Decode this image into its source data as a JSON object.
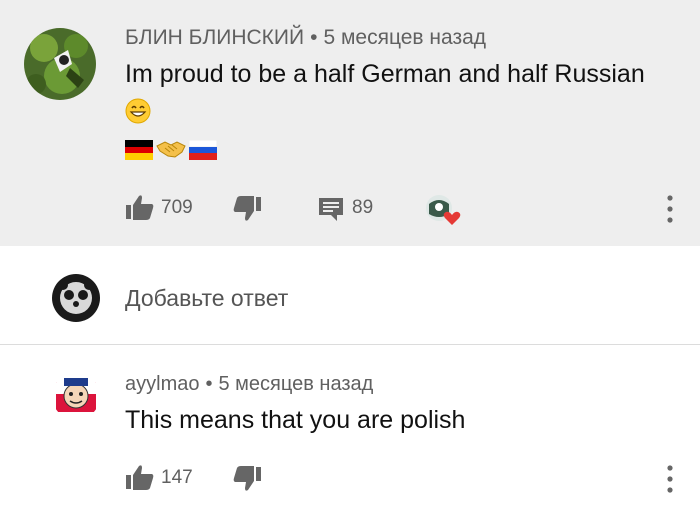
{
  "comment": {
    "author": "БЛИН БЛИНСКИЙ",
    "separator": "•",
    "time": "5 месяцев назад",
    "text": "Im proud to be a half German and half Russian",
    "emoji_line1": "grinning-face-emoji",
    "emoji_line2": [
      "germany-flag",
      "handshake",
      "russia-flag"
    ],
    "likes": "709",
    "replies": "89"
  },
  "reply_box": {
    "placeholder": "Добавьте ответ"
  },
  "reply": {
    "author": "ayylmao",
    "separator": "•",
    "time": "5 месяцев назад",
    "text": "This means that you are polish",
    "likes": "147"
  },
  "colors": {
    "highlight_bg": "#eeeeee",
    "meta_text": "#606060",
    "icon_gray": "#666666",
    "heart": "#e53935"
  }
}
